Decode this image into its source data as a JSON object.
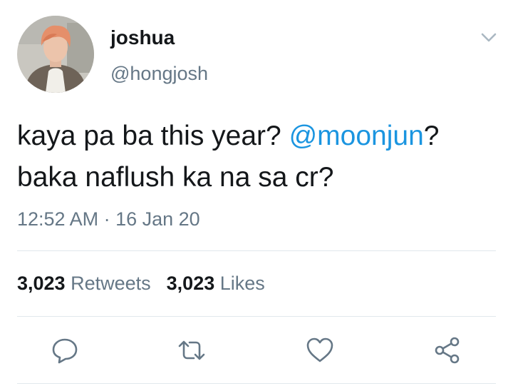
{
  "tweet": {
    "author": {
      "display_name": "joshua",
      "handle": "@hongjosh"
    },
    "text": {
      "line1_before": "kaya pa ba this year? ",
      "mention": "@moonjun",
      "line1_after": "?",
      "line2": "baka naflush ka na sa cr?"
    },
    "timestamp": "12:52 AM · 16 Jan 20",
    "stats": {
      "retweets_count": "3,023",
      "retweets_label": "Retweets",
      "likes_count": "3,023",
      "likes_label": "Likes"
    },
    "actions": {
      "reply_icon": "reply-icon",
      "retweet_icon": "retweet-icon",
      "like_icon": "heart-icon",
      "share_icon": "share-icon"
    },
    "colors": {
      "mention": "#1b95e0",
      "secondary_text": "#657786",
      "primary_text": "#14171a",
      "divider": "#e1e8ed"
    }
  }
}
